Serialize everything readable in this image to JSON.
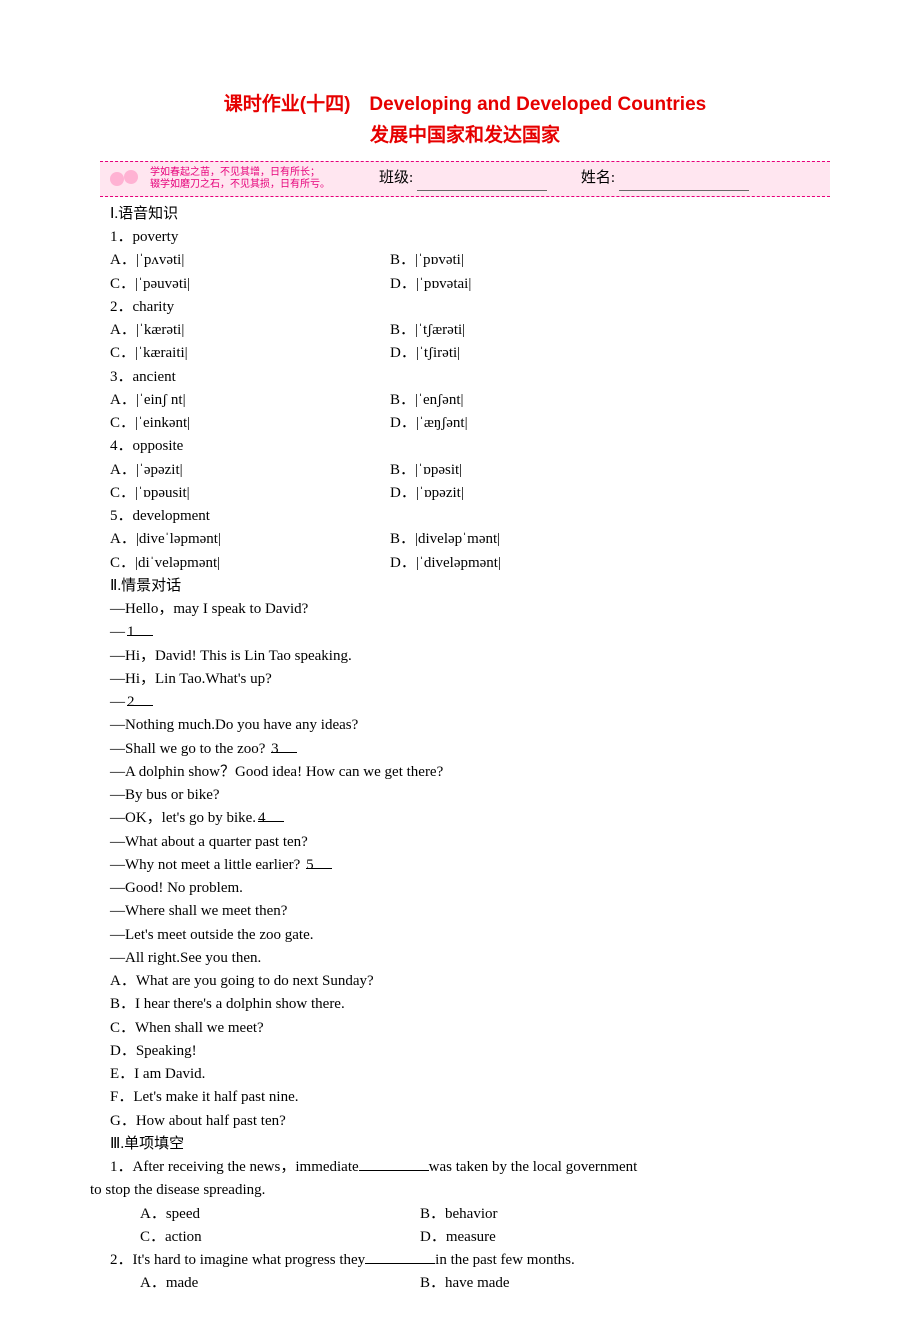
{
  "title": "课时作业(十四)　Developing and Developed Countries",
  "subtitle": "发展中国家和发达国家",
  "banner": {
    "motto_line1": "学如春起之苗，不见其增，日有所长；",
    "motto_line2": "辍学如磨刀之石，不见其损，日有所亏。",
    "class_label": "班级:",
    "name_label": "姓名:"
  },
  "section1_label": "Ⅰ.语音知识",
  "q1": {
    "num": "1．poverty",
    "a": "A．|ˈpʌvəti|",
    "b": "B．|ˈpɒvəti|",
    "c": "C．|ˈpəuvəti|",
    "d": "D．|ˈpɒvətai|"
  },
  "q2": {
    "num": "2．charity",
    "a": "A．|ˈkærəti|",
    "b": "B．|ˈtʃærəti|",
    "c": "C．|ˈkæraiti|",
    "d": "D．|ˈtʃirəti|"
  },
  "q3": {
    "num": "3．ancient",
    "a": "A．|ˈeinʃ nt|",
    "b": "B．|ˈenʃənt|",
    "c": "C．|ˈeinkənt|",
    "d": "D．|ˈæŋʃənt|"
  },
  "q4": {
    "num": "4．opposite",
    "a": "A．|ˈəpəzit|",
    "b": "B．|ˈɒpəsit|",
    "c": "C．|ˈɒpəusit|",
    "d": "D．|ˈɒpəzit|"
  },
  "q5": {
    "num": "5．development",
    "a": "A．|diveˈləpmənt|",
    "b": "B．|diveləpˈmənt|",
    "c": "C．|diˈveləpmənt|",
    "d": "D．|ˈdiveləpmənt|"
  },
  "section2_label": "Ⅱ.情景对话",
  "dlg": {
    "l1": "—Hello，may I speak to David?",
    "l2_pre": "—",
    "l2_num": "1",
    "l3": "—Hi，David! This is Lin Tao speaking.",
    "l4": "—Hi，Lin Tao.What's up?",
    "l5_pre": "—",
    "l5_num": "2",
    "l6": "—Nothing much.Do you have any ideas?",
    "l7_pre": "—Shall we go to the zoo? ",
    "l7_num": "3",
    "l8": "—A dolphin show？Good idea! How can we get there?",
    "l9": "—By bus or bike?",
    "l10_pre": "—OK，let's go by bike.",
    "l10_num": "4",
    "l11": "—What about a quarter past ten?",
    "l12_pre": "—Why not meet a little earlier? ",
    "l12_num": "5",
    "l13": "—Good! No problem.",
    "l14": "—Where shall we meet then?",
    "l15": "—Let's meet outside the zoo gate.",
    "l16": "—All right.See you then."
  },
  "choices": {
    "a": "A．What are you going to do next Sunday?",
    "b": "B．I hear there's a dolphin show there.",
    "c": "C．When shall we meet?",
    "d": "D．Speaking!",
    "e": "E．I am David.",
    "f": "F．Let's make it half past nine.",
    "g": "G．How about half past ten?"
  },
  "section3_label": "Ⅲ.单项填空",
  "mc1": {
    "stem_pre": "1．After receiving the news，immediate",
    "stem_post": "was taken by the local government",
    "stem_line2": "to stop the disease spreading.",
    "a": "A．speed",
    "b": "B．behavior",
    "c": "C．action",
    "d": "D．measure"
  },
  "mc2": {
    "stem_pre": "2．It's hard to imagine what progress they",
    "stem_post": "in the past few months.",
    "a": "A．made",
    "b": "B．have made"
  }
}
